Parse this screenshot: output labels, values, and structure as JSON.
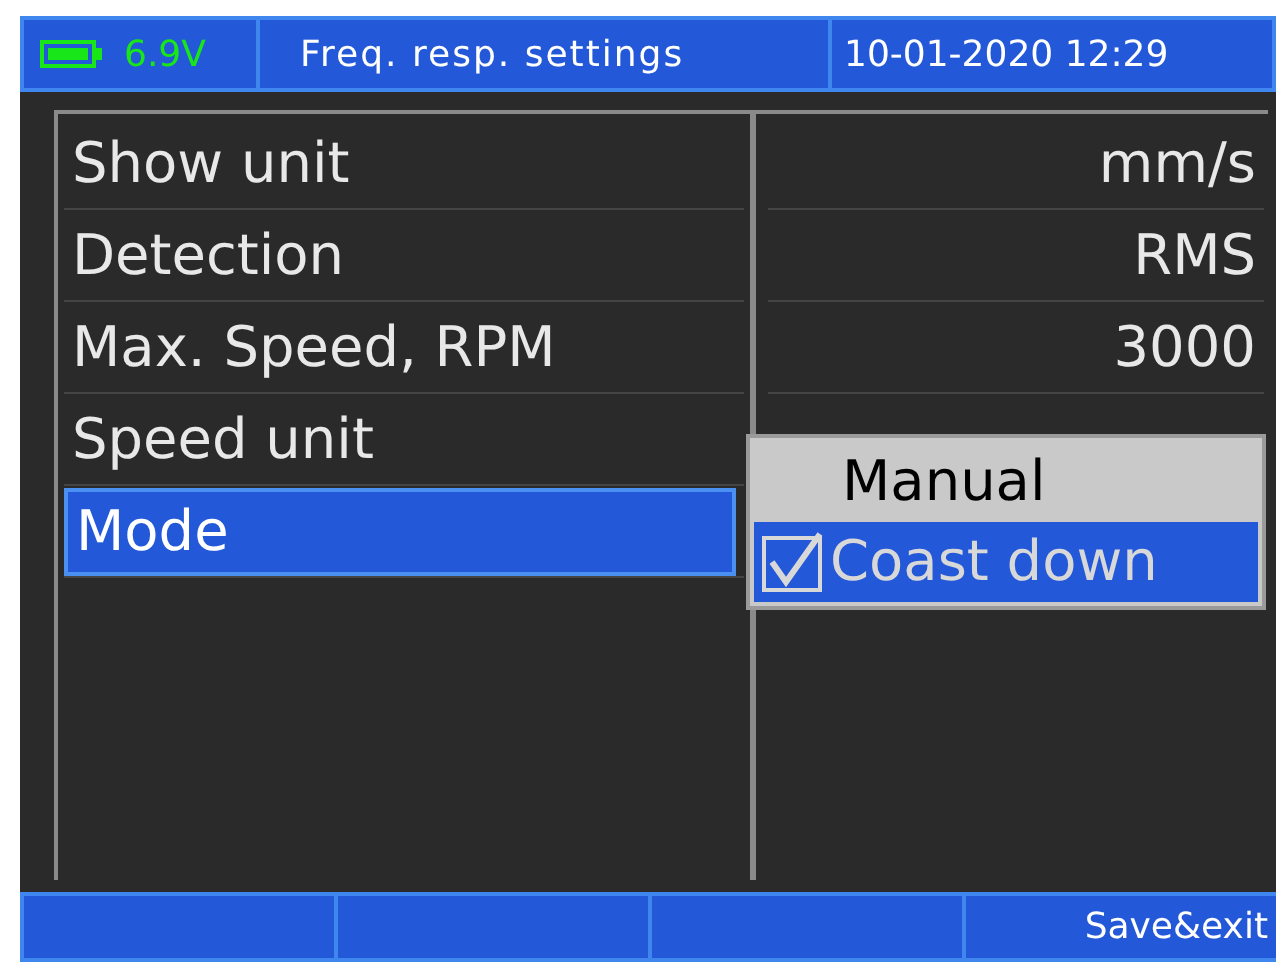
{
  "status_bar": {
    "battery": "6.9V",
    "title": "Freq. resp. settings",
    "datetime": "10-01-2020 12:29"
  },
  "settings": [
    {
      "label": "Show unit",
      "value": "mm/s",
      "selected": false
    },
    {
      "label": "Detection",
      "value": "RMS",
      "selected": false
    },
    {
      "label": "Max. Speed, RPM",
      "value": "3000",
      "selected": false
    },
    {
      "label": "Speed unit",
      "selected": false
    },
    {
      "label": "Mode",
      "selected": true
    }
  ],
  "dropdown": {
    "options": [
      {
        "label": "Manual",
        "selected": false,
        "checked": false
      },
      {
        "label": "Coast down",
        "selected": true,
        "checked": true
      }
    ]
  },
  "softkeys": [
    {
      "kind": "blank"
    },
    {
      "kind": "blank"
    },
    {
      "kind": "blank"
    },
    {
      "kind": "labeled",
      "label": "Save&exit"
    }
  ]
}
